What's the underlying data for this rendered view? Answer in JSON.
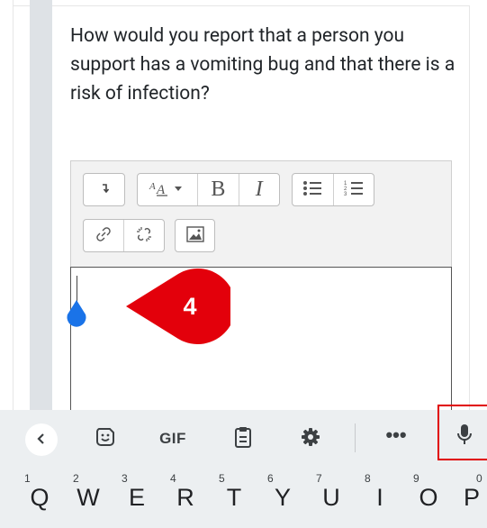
{
  "question": {
    "text": "How would you report that a person you support has a vomiting bug and that there is a risk of infection?"
  },
  "editor": {
    "toolbar": {
      "collapse_icon": "collapse-toolbar-icon",
      "font_style_icon": "font-style-icon",
      "bold_label": "B",
      "italic_label": "I",
      "unordered_list_icon": "bullet-list-icon",
      "ordered_list_icon": "numbered-list-icon",
      "link_icon": "link-icon",
      "unlink_icon": "unlink-icon",
      "image_icon": "image-icon"
    },
    "content": ""
  },
  "annotation": {
    "step_number": "4",
    "color": "#e3000b"
  },
  "keyboard": {
    "toolbar": {
      "back_icon": "chevron-left-icon",
      "sticker_icon": "sticker-icon",
      "gif_label": "GIF",
      "clipboard_icon": "clipboard-icon",
      "settings_icon": "gear-icon",
      "more_label": "•••",
      "mic_icon": "microphone-icon"
    },
    "row1": [
      {
        "letter": "Q",
        "hint": "1"
      },
      {
        "letter": "W",
        "hint": "2"
      },
      {
        "letter": "E",
        "hint": "3"
      },
      {
        "letter": "R",
        "hint": "4"
      },
      {
        "letter": "T",
        "hint": "5"
      },
      {
        "letter": "Y",
        "hint": "6"
      },
      {
        "letter": "U",
        "hint": "7"
      },
      {
        "letter": "I",
        "hint": "8"
      },
      {
        "letter": "O",
        "hint": "9"
      },
      {
        "letter": "P",
        "hint": "0"
      }
    ],
    "highlight_color": "#e00000"
  }
}
